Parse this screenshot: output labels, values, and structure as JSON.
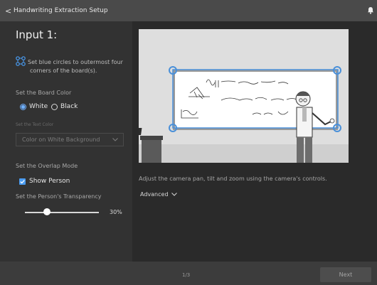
{
  "titlebar": {
    "back_glyph": "<",
    "title": "Handwriting Extraction Setup",
    "bell_icon": "bell-icon"
  },
  "left": {
    "heading": "Input 1:",
    "instruction_line1": "Set blue circles to outermost four",
    "instruction_line2": "corners of the board(s).",
    "board_color_label": "Set the Board Color",
    "board_color_options": [
      "White",
      "Black"
    ],
    "board_color_selected": "White",
    "text_color_label": "Set the Text Color",
    "text_color_value": "Color on White Background",
    "overlap_label": "Set the Overlap Mode",
    "show_person_label": "Show Person",
    "show_person_checked": true,
    "transparency_label": "Set the Person's Transparency",
    "transparency_value": "30%",
    "transparency_level": 0.3
  },
  "right": {
    "adjust_text": "Adjust the camera pan, tilt and zoom using the camera's controls.",
    "advanced_label": "Advanced"
  },
  "footer": {
    "page_indicator": "1/3",
    "next_label": "Next"
  },
  "colors": {
    "accent": "#4a9cf1",
    "corner_handle": "#4a90d9"
  }
}
